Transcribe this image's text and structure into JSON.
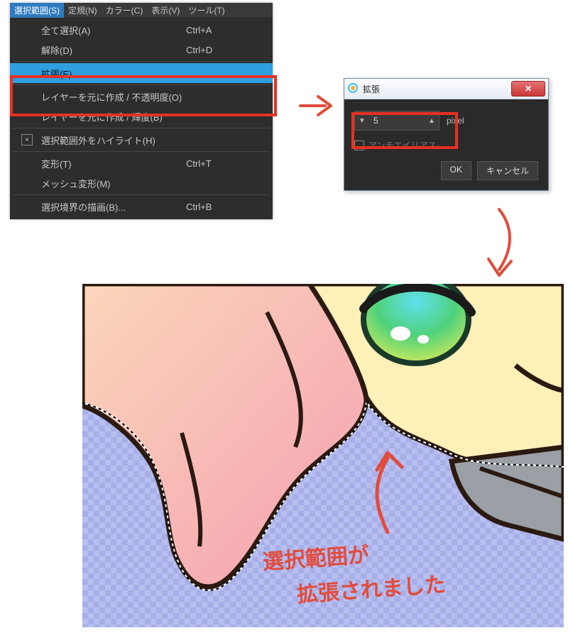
{
  "menu": {
    "bar": {
      "selection": "選択範囲(S)",
      "ruler": "定規(N)",
      "color": "カラー(C)",
      "view": "表示(V)",
      "tool": "ツール(T)"
    },
    "items": {
      "selectAll": {
        "label": "全て選択(A)",
        "shortcut": "Ctrl+A"
      },
      "deselect": {
        "label": "解除(D)",
        "shortcut": "Ctrl+D"
      },
      "expand": {
        "label": "拡張(E)...",
        "shortcut": ""
      },
      "fromLayerO": {
        "label": "レイヤーを元に作成 / 不透明度(O)",
        "shortcut": ""
      },
      "fromLayerB": {
        "label": "レイヤーを元に作成 / 輝度(B)",
        "shortcut": ""
      },
      "highlight": {
        "label": "選択範囲外をハイライト(H)",
        "shortcut": ""
      },
      "transform": {
        "label": "変形(T)",
        "shortcut": "Ctrl+T"
      },
      "mesh": {
        "label": "メッシュ変形(M)",
        "shortcut": ""
      },
      "drawBorder": {
        "label": "選択境界の描画(B)...",
        "shortcut": "Ctrl+B"
      }
    }
  },
  "dialog": {
    "title": "拡張",
    "value": "5",
    "unit": "pixel",
    "checkbox_label": "アンチエイリアス",
    "ok": "OK",
    "cancel": "キャンセル"
  },
  "annotations": {
    "line1": "選択範囲が",
    "line2": "拡張されました"
  },
  "colors": {
    "accent_red": "#e63022",
    "menu_bg": "#2d2d2d",
    "menu_highlight": "#2f9fe0"
  }
}
